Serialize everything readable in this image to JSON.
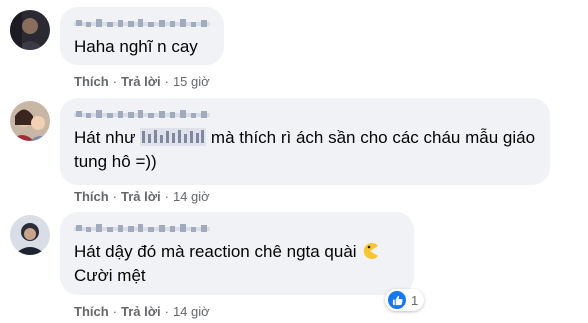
{
  "comments": [
    {
      "text": "Haha nghĩ n cay",
      "actions": {
        "like": "Thích",
        "reply": "Trả lời",
        "time": "15 giờ"
      }
    },
    {
      "text_before": "Hát như ",
      "text_after": " mà thích rì ách sần cho các cháu mẫu giáo tung hô =))",
      "actions": {
        "like": "Thích",
        "reply": "Trả lời",
        "time": "14 giờ"
      }
    },
    {
      "text_line1": "Hát dậy đó mà reaction chê ngta quài",
      "text_line2": "Cười mệt",
      "emoji": "pac-man-icon",
      "actions": {
        "like": "Thích",
        "reply": "Trả lời",
        "time": "14 giờ"
      },
      "reaction": {
        "icon": "thumbs-up-icon",
        "count": "1"
      }
    }
  ],
  "colors": {
    "bubble": "#f0f2f5",
    "meta": "#65676b",
    "like": "#1877f2"
  }
}
